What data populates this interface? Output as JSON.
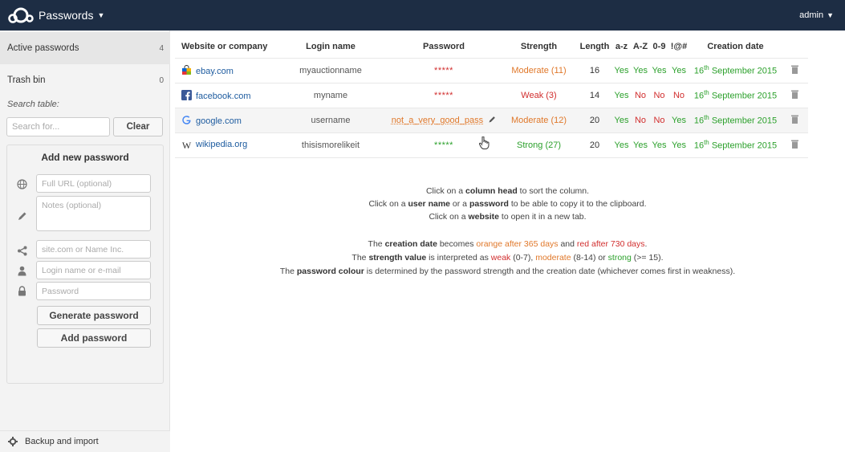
{
  "header": {
    "app_title": "Passwords",
    "user": "admin"
  },
  "sidebar": {
    "items": [
      {
        "label": "Active passwords",
        "count": "4"
      },
      {
        "label": "Trash bin",
        "count": "0"
      }
    ],
    "search_label": "Search table:",
    "search_placeholder": "Search for...",
    "clear_label": "Clear",
    "add_title": "Add new password",
    "fields": {
      "url_placeholder": "Full URL (optional)",
      "notes_placeholder": "Notes (optional)",
      "site_placeholder": "site.com or Name Inc.",
      "login_placeholder": "Login name or e-mail",
      "password_placeholder": "Password"
    },
    "generate_label": "Generate password",
    "add_label": "Add password",
    "footer_label": "Backup and import"
  },
  "table": {
    "columns": [
      "Website or company",
      "Login name",
      "Password",
      "Strength",
      "Length",
      "a-z",
      "A-Z",
      "0-9",
      "!@#",
      "Creation date"
    ],
    "rows": [
      {
        "site": "ebay.com",
        "icon": "ebay-icon",
        "login": "myauctionname",
        "password": "*****",
        "strength": "Moderate (11)",
        "length": "16",
        "az": "Yes",
        "AZ": "Yes",
        "num": "Yes",
        "sym": "Yes",
        "day": "16",
        "day_suffix": "th",
        "date_rest": "September 2015"
      },
      {
        "site": "facebook.com",
        "icon": "facebook-icon",
        "login": "myname",
        "password": "*****",
        "strength": "Weak (3)",
        "length": "14",
        "az": "Yes",
        "AZ": "No",
        "num": "No",
        "sym": "No",
        "day": "16",
        "day_suffix": "th",
        "date_rest": "September 2015"
      },
      {
        "site": "google.com",
        "icon": "google-icon",
        "login": "username",
        "password": "not_a_very_good_pass",
        "strength": "Moderate (12)",
        "length": "20",
        "az": "Yes",
        "AZ": "No",
        "num": "No",
        "sym": "Yes",
        "day": "16",
        "day_suffix": "th",
        "date_rest": "September 2015"
      },
      {
        "site": "wikipedia.org",
        "icon": "wikipedia-icon",
        "login": "thisismorelikeit",
        "password": "*****",
        "strength": "Strong (27)",
        "length": "20",
        "az": "Yes",
        "AZ": "Yes",
        "num": "Yes",
        "sym": "Yes",
        "day": "16",
        "day_suffix": "th",
        "date_rest": "September 2015"
      }
    ]
  },
  "info": {
    "l1_a": "Click on a ",
    "l1_b": "column head",
    "l1_c": " to sort the column.",
    "l2_a": "Click on a ",
    "l2_b": "user name",
    "l2_c": " or a ",
    "l2_d": "password",
    "l2_e": " to be able to copy it to the clipboard.",
    "l3_a": "Click on a ",
    "l3_b": "website",
    "l3_c": " to open it in a new tab.",
    "l4_a": "The ",
    "l4_b": "creation date",
    "l4_c": " becomes ",
    "l4_d": "orange after 365 days",
    "l4_e": " and ",
    "l4_f": "red after 730 days",
    "l4_g": ".",
    "l5_a": "The ",
    "l5_b": "strength value",
    "l5_c": " is interpreted as ",
    "l5_d": "weak",
    "l5_e": " (0-7), ",
    "l5_f": "moderate",
    "l5_g": " (8-14) or ",
    "l5_h": "strong",
    "l5_i": " (>= 15).",
    "l6_a": "The ",
    "l6_b": "password colour",
    "l6_c": " is determined by the password strength and the creation date (whichever comes first in weakness)."
  },
  "colors": {
    "header_bg": "#1d2d44",
    "weak": "#d12e2e",
    "moderate": "#e0782a",
    "strong": "#2ba02b",
    "link": "#1d5b9f"
  }
}
